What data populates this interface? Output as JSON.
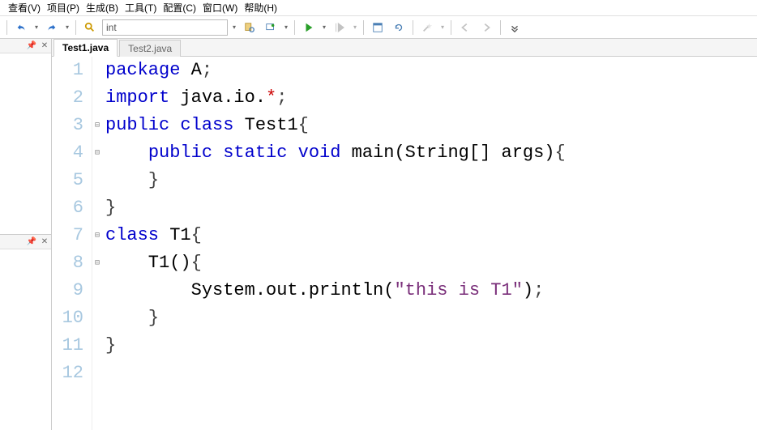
{
  "menu": {
    "view": "查看(V)",
    "project": "项目(P)",
    "build": "生成(B)",
    "tools": "工具(T)",
    "config": "配置(C)",
    "window": "窗口(W)",
    "help": "帮助(H)"
  },
  "toolbar": {
    "search_value": "int"
  },
  "tabs": [
    {
      "label": "Test1.java",
      "active": true
    },
    {
      "label": "Test2.java",
      "active": false
    }
  ],
  "code": {
    "lines": [
      {
        "n": 1,
        "fold": "",
        "tokens": [
          [
            "kw",
            "package"
          ],
          [
            "pkg",
            " A"
          ],
          [
            "sym",
            ";"
          ]
        ]
      },
      {
        "n": 2,
        "fold": "",
        "tokens": [
          [
            "kw",
            "import"
          ],
          [
            "pkg",
            " java.io."
          ],
          [
            "star",
            "*"
          ],
          [
            "sym",
            ";"
          ]
        ]
      },
      {
        "n": 3,
        "fold": "⊟",
        "tokens": [
          [
            "kw",
            "public class"
          ],
          [
            "pkg",
            " Test1"
          ],
          [
            "sym",
            "{"
          ]
        ]
      },
      {
        "n": 4,
        "fold": "⊟",
        "tokens": [
          [
            "pkg",
            "    "
          ],
          [
            "kw",
            "public static void"
          ],
          [
            "pkg",
            " main(String[] args)"
          ],
          [
            "sym",
            "{"
          ]
        ]
      },
      {
        "n": 5,
        "fold": "",
        "tokens": [
          [
            "pkg",
            "    "
          ],
          [
            "sym",
            "}"
          ]
        ]
      },
      {
        "n": 6,
        "fold": "",
        "tokens": [
          [
            "sym",
            "}"
          ]
        ]
      },
      {
        "n": 7,
        "fold": "⊟",
        "tokens": [
          [
            "kw",
            "class"
          ],
          [
            "pkg",
            " T1"
          ],
          [
            "sym",
            "{"
          ]
        ]
      },
      {
        "n": 8,
        "fold": "⊟",
        "tokens": [
          [
            "pkg",
            "    T1()"
          ],
          [
            "sym",
            "{"
          ]
        ]
      },
      {
        "n": 9,
        "fold": "",
        "tokens": [
          [
            "pkg",
            "        System.out.println("
          ],
          [
            "str",
            "\"this is T1\""
          ],
          [
            "pkg",
            ")"
          ],
          [
            "sym",
            ";"
          ]
        ]
      },
      {
        "n": 10,
        "fold": "",
        "tokens": [
          [
            "pkg",
            "    "
          ],
          [
            "sym",
            "}"
          ]
        ]
      },
      {
        "n": 11,
        "fold": "",
        "tokens": [
          [
            "sym",
            "}"
          ]
        ]
      },
      {
        "n": 12,
        "fold": "",
        "tokens": []
      }
    ]
  }
}
